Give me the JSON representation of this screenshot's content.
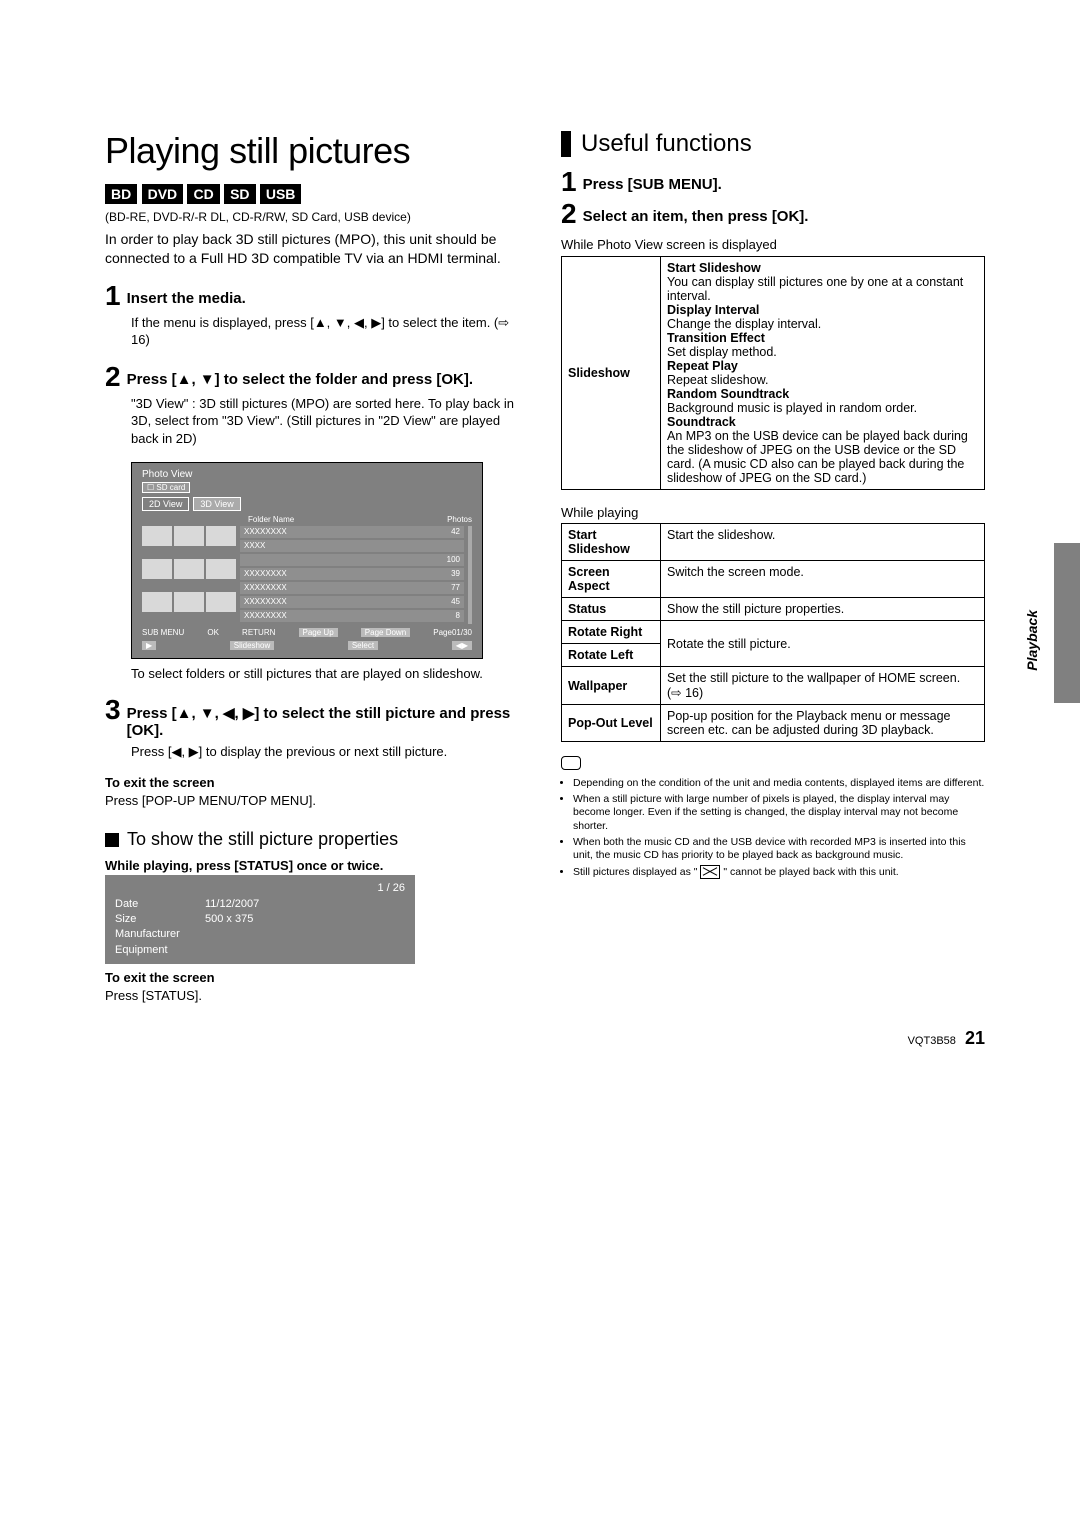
{
  "left": {
    "title": "Playing still pictures",
    "media_tags": [
      "BD",
      "DVD",
      "CD",
      "SD",
      "USB"
    ],
    "media_line": "(BD-RE, DVD-R/-R DL, CD-R/RW, SD Card, USB device)",
    "intro": "In order to play back 3D still pictures (MPO), this unit should be connected to a Full HD 3D compatible TV via an HDMI terminal.",
    "steps": [
      {
        "num": "1",
        "title": "Insert the media.",
        "body": "If the menu is displayed, press [▲, ▼, ◀, ▶] to select the item. (⇨ 16)"
      },
      {
        "num": "2",
        "title": "Press [▲, ▼] to select the folder and press [OK].",
        "body": "\"3D View\" : 3D still pictures (MPO) are sorted here. To play back in 3D, select from \"3D View\". (Still pictures in \"2D View\" are played back in 2D)"
      },
      {
        "num": "3",
        "title": "Press [▲, ▼, ◀, ▶] to select the still picture and press [OK].",
        "body": "Press [◀, ▶] to display the previous or next still picture."
      }
    ],
    "photoview": {
      "header": "Photo View",
      "card": "SD card",
      "tab1": "2D View",
      "tab2": "3D View",
      "col1": "Folder Name",
      "col2": "Photos",
      "rows": [
        [
          "XXXXXXXX",
          "42"
        ],
        [
          "XXXX",
          ""
        ],
        [
          "",
          "100"
        ],
        [
          "XXXXXXXX",
          "39"
        ],
        [
          "XXXXXXXX",
          "77"
        ],
        [
          "XXXXXXXX",
          "45"
        ],
        [
          "XXXXXXXX",
          "8"
        ]
      ],
      "f1": "SUB MENU",
      "f2": "OK",
      "f3": "RETURN",
      "f4": "Page Up",
      "f5": "Page Down",
      "f6": "Page01/30",
      "f7": "Slideshow",
      "f8": "Select"
    },
    "step2_after": "To select folders or still pictures that are played on slideshow.",
    "exit1_h": "To exit the screen",
    "exit1_b": "Press [POP-UP MENU/TOP MENU].",
    "prop_heading": "To show the still picture properties",
    "prop_instr": "While playing, press [STATUS] once or twice.",
    "status": {
      "counter": "1 / 26",
      "rows": [
        [
          "Date",
          "11/12/2007"
        ],
        [
          "Size",
          "500 x 375"
        ],
        [
          "Manufacturer",
          ""
        ],
        [
          "Equipment",
          ""
        ]
      ]
    },
    "exit2_h": "To exit the screen",
    "exit2_b": "Press [STATUS]."
  },
  "right": {
    "heading": "Useful functions",
    "step1": "Press [SUB MENU].",
    "step2": "Select an item, then press [OK].",
    "table1_caption": "While Photo View screen is displayed",
    "slideshow": {
      "head": "Slideshow",
      "items": [
        {
          "h": "Start Slideshow",
          "b": "You can display still pictures one by one at a constant interval."
        },
        {
          "h": "Display Interval",
          "b": "Change the display interval."
        },
        {
          "h": "Transition Effect",
          "b": "Set display method."
        },
        {
          "h": "Repeat Play",
          "b": "Repeat slideshow."
        },
        {
          "h": "Random Soundtrack",
          "b": "Background music is played in random order."
        },
        {
          "h": "Soundtrack",
          "b": "An MP3 on the USB device can be played back during the slideshow of JPEG on the USB device or the SD card. (A music CD also can be played back during the slideshow of JPEG on the SD card.)"
        }
      ]
    },
    "table2_caption": "While playing",
    "table2": [
      {
        "h": "Start Slideshow",
        "b": "Start the slideshow."
      },
      {
        "h": "Screen Aspect",
        "b": "Switch the screen mode."
      },
      {
        "h": "Status",
        "b": "Show the still picture properties."
      },
      {
        "h": "Rotate Right",
        "b": "Rotate the still picture.",
        "merge_next": true
      },
      {
        "h": "Rotate Left",
        "b": ""
      },
      {
        "h": "Wallpaper",
        "b": "Set the still picture to the wallpaper of HOME screen. (⇨ 16)"
      },
      {
        "h": "Pop-Out Level",
        "b": "Pop-up position for the Playback menu or message screen etc. can be adjusted during 3D playback."
      }
    ],
    "notes": [
      "Depending on the condition of the unit and media contents, displayed items are different.",
      "When a still picture with large number of pixels is played, the display interval may become longer. Even if the setting is changed, the display interval may not become shorter.",
      "When both the music CD and the USB device with recorded MP3 is inserted into this unit, the music CD has priority to be played back as background music.",
      "Still pictures displayed as \" ⊠ \" cannot be played back with this unit."
    ],
    "side_tab": "Playback"
  },
  "footer": {
    "code": "VQT3B58",
    "page": "21"
  }
}
